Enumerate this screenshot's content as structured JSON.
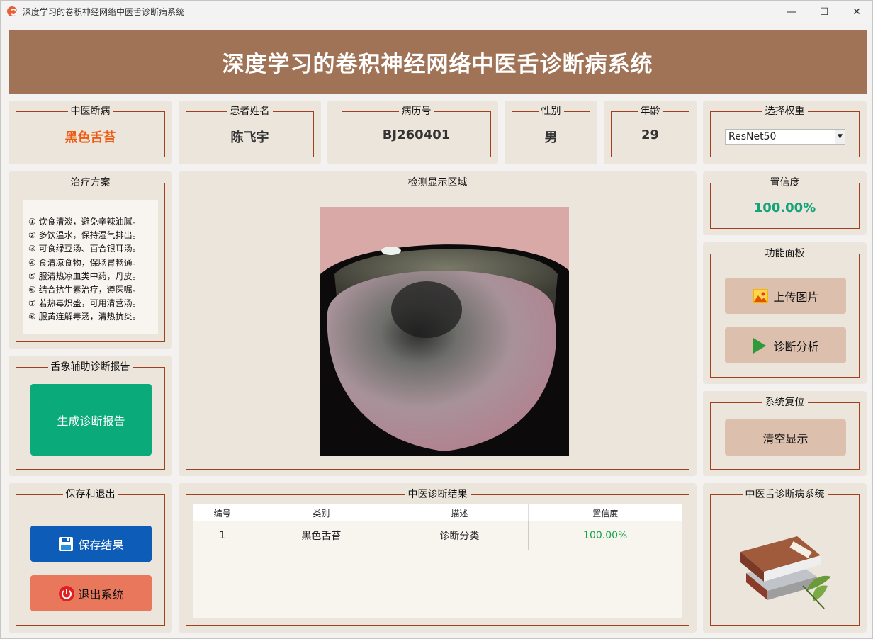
{
  "window": {
    "title": "深度学习的卷积神经网络中医舌诊断病系统"
  },
  "banner": {
    "title": "深度学习的卷积神经网络中医舌诊断病系统"
  },
  "info": {
    "diagnosis_label": "中医断病",
    "diagnosis_value": "黑色舌苔",
    "name_label": "患者姓名",
    "name_value": "陈飞宇",
    "record_label": "病历号",
    "record_value": "BJ260401",
    "gender_label": "性别",
    "gender_value": "男",
    "age_label": "年龄",
    "age_value": "29",
    "weight_label": "选择权重",
    "weight_value": "ResNet50"
  },
  "treatment": {
    "title": "治疗方案",
    "items": [
      "① 饮食清淡，避免辛辣油腻。",
      "② 多饮温水，保持湿气排出。",
      "③ 可食绿豆汤、百合银耳汤。",
      "④ 食清凉食物，保肠胃畅通。",
      "⑤ 服清热凉血类中药，丹皮。",
      "⑥ 结合抗生素治疗，遵医嘱。",
      "⑦ 若热毒炽盛，可用清营汤。",
      "⑧ 服黄连解毒汤，清热抗炎。"
    ]
  },
  "report": {
    "title": "舌象辅助诊断报告",
    "button": "生成诊断报告"
  },
  "save_exit": {
    "title": "保存和退出",
    "save_button": "保存结果",
    "exit_button": "退出系统"
  },
  "detect": {
    "title": "检测显示区域"
  },
  "confidence": {
    "title": "置信度",
    "value": "100.00%"
  },
  "functions": {
    "title": "功能面板",
    "upload_button": "上传图片",
    "diagnose_button": "诊断分析"
  },
  "reset": {
    "title": "系统复位",
    "clear_button": "清空显示"
  },
  "results": {
    "title": "中医诊断结果",
    "headers": [
      "编号",
      "类别",
      "描述",
      "置信度"
    ],
    "rows": [
      [
        "1",
        "黑色舌苔",
        "诊断分类",
        "100.00%"
      ]
    ]
  },
  "logo": {
    "title": "中医舌诊断病系统"
  },
  "colors": {
    "banner": "#a07356",
    "diagnosis": "#ee5a10",
    "confidence": "#17a37a",
    "report_button": "#0aaa7a",
    "save_button": "#0d5cb8",
    "exit_button": "#e8775c",
    "function_button": "#dcc0ad"
  }
}
